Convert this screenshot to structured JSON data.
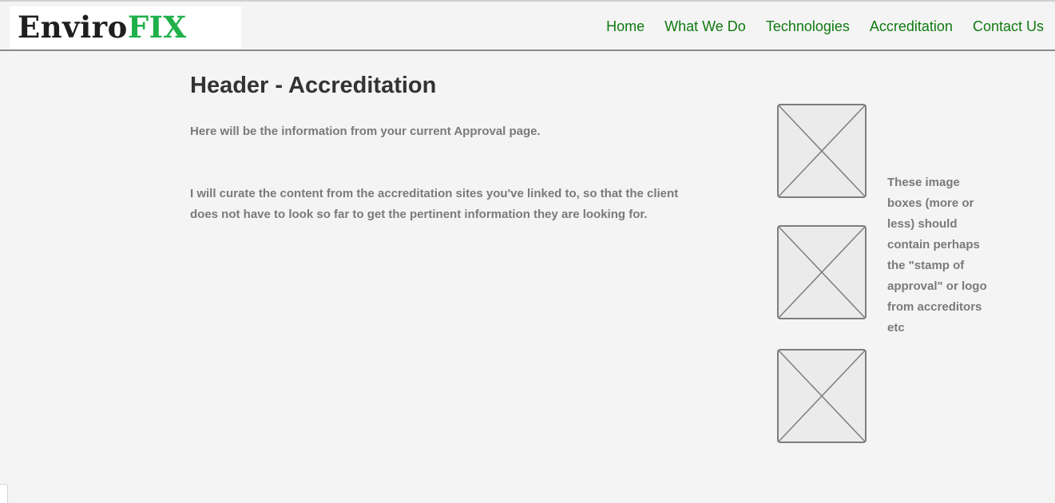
{
  "logo": {
    "part1": "Enviro",
    "part2": "FIX",
    "color_part1": "#1f1f1f",
    "color_part2": "#1fb04a"
  },
  "nav": {
    "items": [
      {
        "label": "Home"
      },
      {
        "label": "What We Do"
      },
      {
        "label": "Technologies"
      },
      {
        "label": "Accreditation"
      },
      {
        "label": "Contact Us"
      }
    ],
    "color": "#107a10"
  },
  "main": {
    "title": "Header - Accreditation",
    "paragraph_1": "Here will be the information from your current Approval page.",
    "paragraph_2": "I will curate the content from the accreditation sites you've linked to, so that the client does not have to look so far to get the pertinent information they are looking for."
  },
  "sidebar": {
    "image_placeholders": [
      {
        "icon": "image-placeholder-icon"
      },
      {
        "icon": "image-placeholder-icon"
      },
      {
        "icon": "image-placeholder-icon"
      }
    ],
    "note": "These image boxes (more or less) should contain perhaps the \"stamp of approval\" or logo from accreditors etc"
  }
}
